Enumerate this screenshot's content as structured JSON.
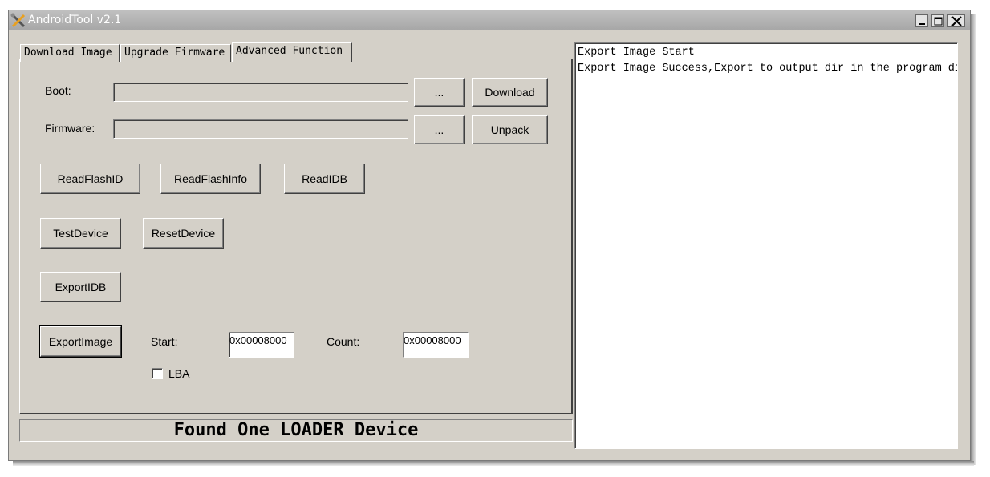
{
  "window": {
    "title": "AndroidTool v2.1"
  },
  "tabs": [
    {
      "label": "Download Image"
    },
    {
      "label": "Upgrade Firmware"
    },
    {
      "label": "Advanced Function"
    }
  ],
  "advanced": {
    "boot_label": "Boot:",
    "firmware_label": "Firmware:",
    "browse_label": "...",
    "download_label": "Download",
    "unpack_label": "Unpack",
    "read_flash_id": "ReadFlashID",
    "read_flash_info": "ReadFlashInfo",
    "read_idb": "ReadIDB",
    "test_device": "TestDevice",
    "reset_device": "ResetDevice",
    "export_idb": "ExportIDB",
    "export_image": "ExportImage",
    "start_label": "Start:",
    "start_value": "0x00008000",
    "count_label": "Count:",
    "count_value": "0x00008000",
    "lba_label": "LBA"
  },
  "status": {
    "text": "Found One LOADER Device"
  },
  "log": {
    "lines": [
      "Export Image Start",
      "Export Image Success,Export to output dir in the program di"
    ]
  },
  "icons": {
    "app": "android-tool-icon",
    "minimize": "minimize-icon",
    "maximize": "maximize-icon",
    "close": "close-icon"
  }
}
